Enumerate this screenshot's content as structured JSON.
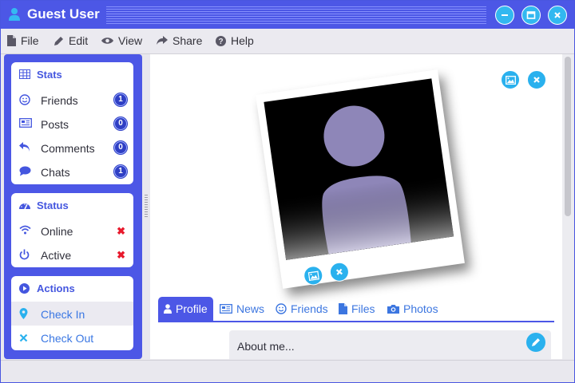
{
  "window": {
    "title": "Guest User"
  },
  "menu": [
    {
      "label": "File",
      "icon": "file-icon"
    },
    {
      "label": "Edit",
      "icon": "pencil-icon"
    },
    {
      "label": "View",
      "icon": "eye-icon"
    },
    {
      "label": "Share",
      "icon": "share-icon"
    },
    {
      "label": "Help",
      "icon": "help-icon"
    }
  ],
  "sidebar": {
    "stats": {
      "title": "Stats",
      "items": [
        {
          "label": "Friends",
          "count": "1"
        },
        {
          "label": "Posts",
          "count": "0"
        },
        {
          "label": "Comments",
          "count": "0"
        },
        {
          "label": "Chats",
          "count": "1"
        }
      ]
    },
    "status": {
      "title": "Status",
      "items": [
        {
          "label": "Online",
          "mark": "✖"
        },
        {
          "label": "Active",
          "mark": "✖"
        }
      ]
    },
    "actions": {
      "title": "Actions",
      "items": [
        {
          "label": "Check In"
        },
        {
          "label": "Check Out"
        }
      ]
    }
  },
  "tabs": [
    {
      "label": "Profile",
      "active": true
    },
    {
      "label": "News"
    },
    {
      "label": "Friends"
    },
    {
      "label": "Files"
    },
    {
      "label": "Photos"
    }
  ],
  "about": {
    "label": "About me..."
  },
  "colors": {
    "accent": "#4c57e6",
    "button": "#2ab1ee",
    "badge": "#2f3fc4",
    "error": "#e8192c",
    "avatar": "#8e86b8"
  }
}
